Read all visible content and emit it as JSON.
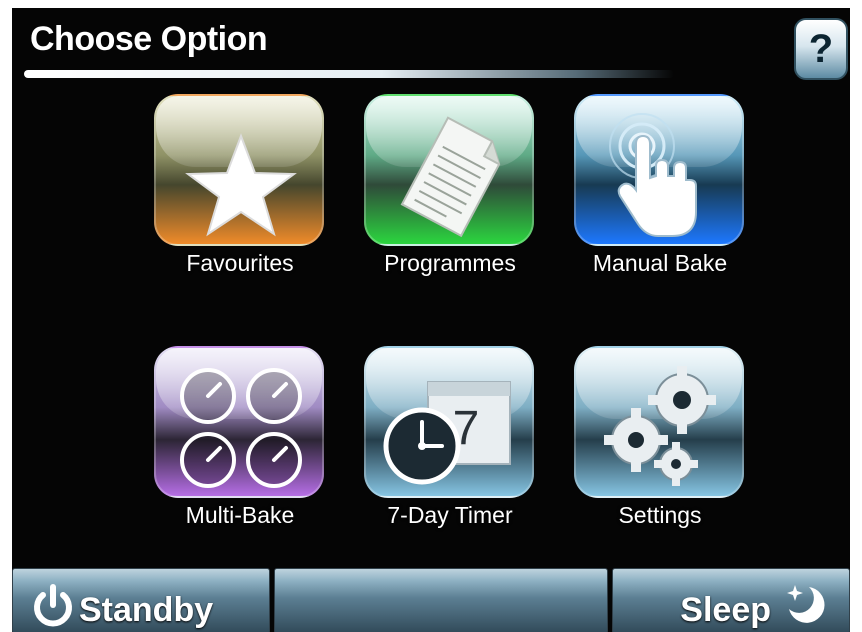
{
  "header": {
    "title": "Choose Option",
    "help_label": "?"
  },
  "tiles": [
    {
      "label": "Favourites",
      "icon": "star-icon"
    },
    {
      "label": "Programmes",
      "icon": "document-icon"
    },
    {
      "label": "Manual Bake",
      "icon": "touch-hand-icon"
    },
    {
      "label": "Multi-Bake",
      "icon": "four-timers-icon"
    },
    {
      "label": "7-Day Timer",
      "icon": "clock-calendar-icon",
      "calendar_number": "7"
    },
    {
      "label": "Settings",
      "icon": "gears-icon"
    }
  ],
  "footer": {
    "standby_label": "Standby",
    "sleep_label": "Sleep"
  },
  "colors": {
    "favourites_accent": "#f08b2a",
    "programmes_accent": "#2bd63f",
    "manual_accent": "#1d78ff",
    "multibake_accent": "#b66ee6",
    "panel_background": "#050505"
  }
}
